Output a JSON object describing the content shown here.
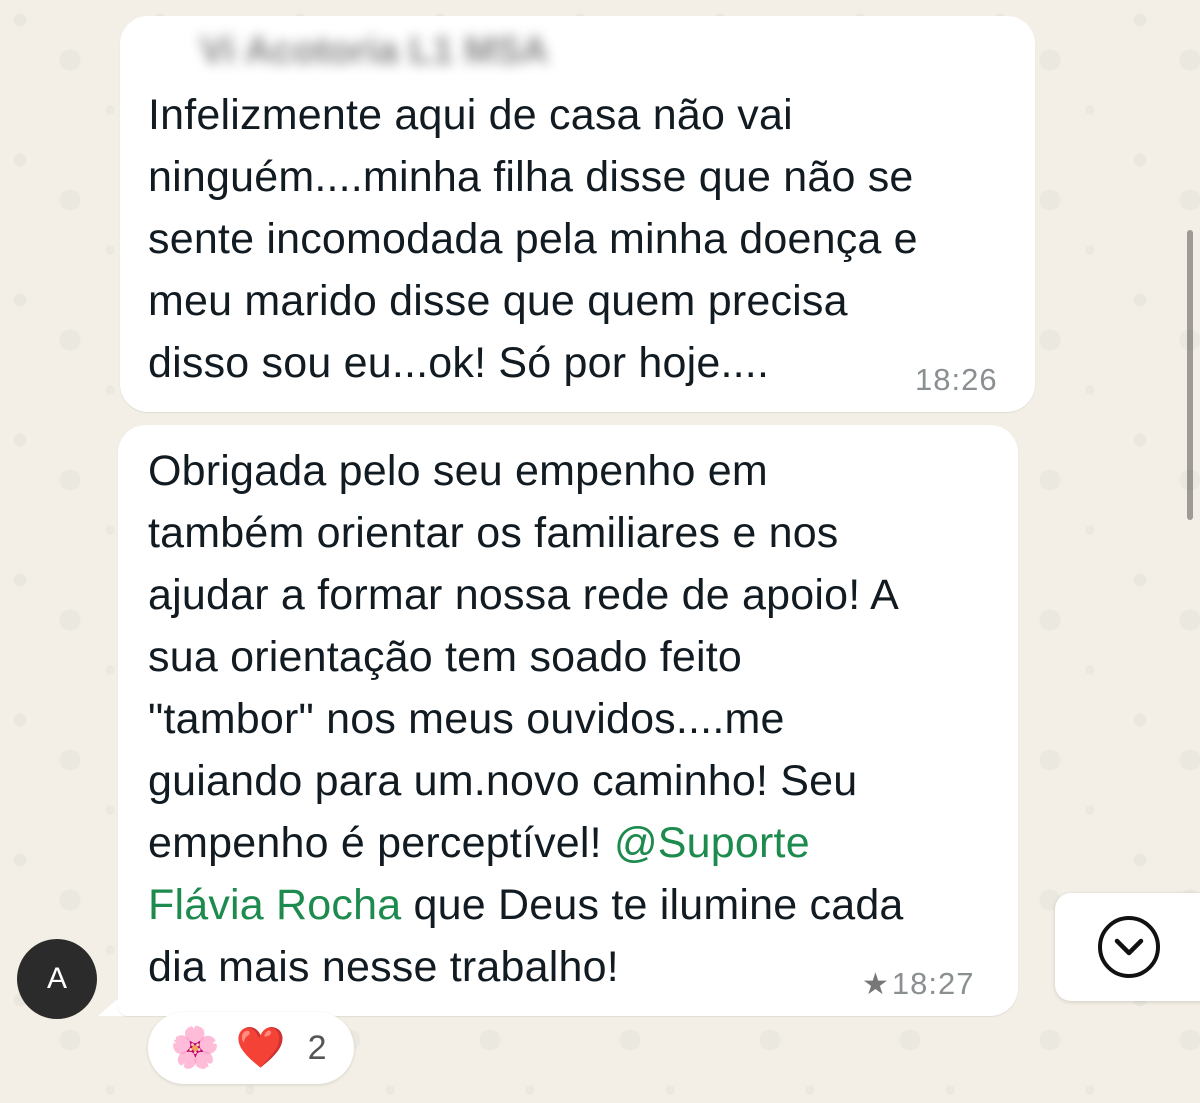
{
  "chat": {
    "messages": [
      {
        "sender": "Vi        Acotoria L1 MSA",
        "lines": [
          "Infelizmente aqui de casa não vai",
          "ninguém....minha filha disse que não se",
          "sente incomodada pela minha doença e",
          "meu marido disse que quem precisa",
          "disso sou eu...ok! Só por hoje...."
        ],
        "time": "18:26"
      },
      {
        "lines": [
          "Obrigada pelo seu empenho em",
          "também orientar os familiares e nos",
          "ajudar a formar nossa rede de apoio! A",
          "sua orientação tem soado feito",
          "\"tambor\" nos meus ouvidos....me",
          "guiando para um.novo caminho! Seu"
        ],
        "line7_prefix": "empenho é perceptível! ",
        "mention_line7": "@Suporte",
        "mention_line8": "Flávia Rocha",
        "line8_suffix": " que Deus te ilumine cada",
        "last_line": "dia mais nesse trabalho!",
        "star": "★",
        "time": "18:27",
        "mention_color": "#1d8a4e"
      }
    ],
    "avatar_letter": "A",
    "reactions": {
      "emojis": [
        "🌸",
        "❤️"
      ],
      "count": "2"
    },
    "scroll_icon": "chevron-down-circle-icon"
  }
}
